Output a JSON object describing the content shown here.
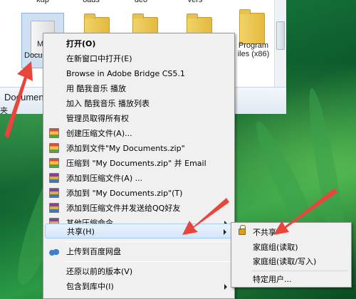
{
  "explorer": {
    "folders": [
      {
        "label": "kup"
      },
      {
        "label": "oads"
      },
      {
        "label": "deo"
      },
      {
        "label": "vers"
      },
      {
        "label": "Program Files (x86)",
        "line1": "Program",
        "line2": "iles (x86)"
      }
    ],
    "selected_folder": {
      "line1": "M",
      "line2": "Docu",
      "line3": "s"
    },
    "status": {
      "line1": "Document",
      "line2": "夹"
    }
  },
  "context_menu": {
    "items": [
      {
        "label": "打开(O)"
      },
      {
        "label": "在新窗口中打开(E)"
      },
      {
        "label": "Browse in Adobe Bridge CS5.1"
      },
      {
        "label": "用 酷我音乐 播放"
      },
      {
        "label": "加入 酷我音乐 播放列表"
      },
      {
        "label": "管理员取得所有权"
      },
      {
        "label": "创建压缩文件(A)..."
      },
      {
        "label": "添加到文件\"My Documents.zip\""
      },
      {
        "label": "压缩到 \"My Documents.zip\" 并 Email"
      },
      {
        "label": "添加到压缩文件(A) ..."
      },
      {
        "label": "添加到 \"My Documents.zip\"(T)"
      },
      {
        "label": "添加到压缩文件并发送给QQ好友"
      },
      {
        "label": "其他压缩命令"
      },
      {
        "label": "共享(H)"
      },
      {
        "label": "上传到百度网盘"
      },
      {
        "label": "还原以前的版本(V)"
      },
      {
        "label": "包含到库中(I)"
      }
    ]
  },
  "share_submenu": {
    "items": [
      {
        "label": "不共享"
      },
      {
        "label": "家庭组(读取)"
      },
      {
        "label": "家庭组(读取/写入)"
      },
      {
        "label": "特定用户..."
      }
    ]
  },
  "colors": {
    "annotation_arrow": "#e8453c",
    "menu_background": "#f0f0f0",
    "highlight": "#d4e6fa"
  }
}
